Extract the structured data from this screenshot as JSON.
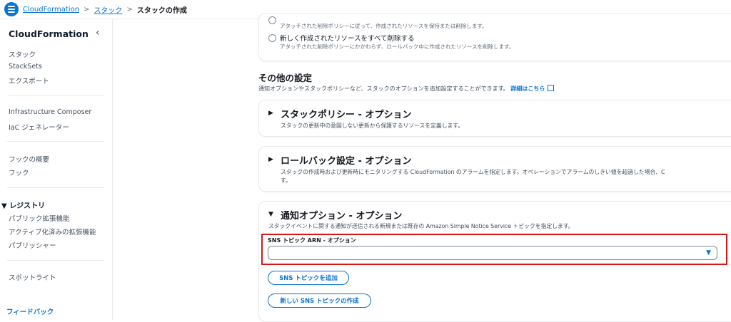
{
  "breadcrumb": {
    "items": [
      "CloudFormation",
      "スタック"
    ],
    "current": "スタックの作成",
    "separator": ">"
  },
  "sidebar": {
    "title": "CloudFormation",
    "close_icon": "‹",
    "items_group1": [
      "スタック",
      "StackSets",
      "エクスポート"
    ],
    "items_group2": [
      "Infrastructure Composer",
      "IaC ジェネレーター"
    ],
    "items_group3": [
      "フックの概要",
      "フック"
    ],
    "registry": {
      "label": "レジストリ",
      "items": [
        "パブリック拡張機能",
        "アクティブ化済みの拡張機能",
        "パブリッシャー"
      ]
    },
    "spotlight": "スポットライト",
    "feedback": "フィードバック"
  },
  "deletion": {
    "option1_desc": "アタッチされた削除ポリシーに従って、作成されたリソースを保持または削除します。",
    "option2_label": "新しく作成されたリソースをすべて削除する",
    "option2_desc": "アタッチされた削除ポリシーにかかわらず、ロールバック中に作成されたリソースを削除します。"
  },
  "other_settings": {
    "title": "その他の設定",
    "desc": "通知オプションやスタックポリシーなど、スタックのオプションを追加設定することができます。",
    "link": "詳細はこちら"
  },
  "sections": {
    "stack_policy": {
      "title": "スタックポリシー - オプション",
      "desc": "スタックの更新中の意図しない更新から保護するリソースを定義します。"
    },
    "rollback": {
      "title": "ロールバック設定 - オプション",
      "desc": "スタックの作成時および更新時にモニタリングする CloudFormation のアラームを指定します。オペレーションでアラームのしきい値を超過した場合、C",
      "desc2": "す。"
    },
    "notification": {
      "title": "通知オプション - オプション",
      "desc": "スタックイベントに関する通知が送信される新規または既存の Amazon Simple Notice Service トピックを指定します。",
      "field_label": "SNS トピック ARN - オプション",
      "field_value": "",
      "add_button": "SNS トピックを追加",
      "create_button": "新しい SNS トピックの作成"
    }
  },
  "colors": {
    "accent": "#0972d3",
    "highlight": "#d91515"
  }
}
